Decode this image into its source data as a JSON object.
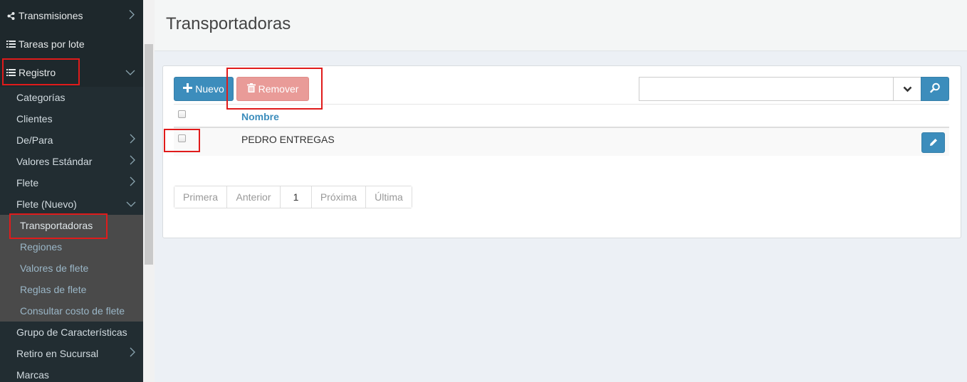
{
  "sidebar": {
    "top_items": [
      {
        "label": "Transmisiones",
        "icon": "share-icon",
        "chevron": "right"
      },
      {
        "label": "Tareas por lote",
        "icon": "list-alt-icon",
        "chevron": ""
      },
      {
        "label": "Registro",
        "icon": "list-icon",
        "chevron": "down"
      }
    ],
    "registro_items": [
      {
        "label": "Categorías"
      },
      {
        "label": "Clientes"
      },
      {
        "label": "De/Para"
      },
      {
        "label": "Valores Estándar"
      },
      {
        "label": "Flete"
      },
      {
        "label": "Flete (Nuevo)"
      }
    ],
    "flete_nuevo_items": [
      {
        "label": "Transportadoras"
      },
      {
        "label": "Regiones"
      },
      {
        "label": "Valores de flete"
      },
      {
        "label": "Reglas de flete"
      },
      {
        "label": "Consultar costo de flete"
      }
    ],
    "after_items": [
      {
        "label": "Grupo de Características"
      },
      {
        "label": "Retiro en Sucursal"
      },
      {
        "label": "Marcas"
      }
    ]
  },
  "header": {
    "title": "Transportadoras"
  },
  "toolbar": {
    "nuevo_label": "Nuevo",
    "remover_label": "Remover",
    "search_value": ""
  },
  "table": {
    "columns": [
      {
        "label": "Nombre"
      }
    ],
    "rows": [
      {
        "nombre": "PEDRO ENTREGAS"
      }
    ]
  },
  "pagination": {
    "first": "Primera",
    "prev": "Anterior",
    "current": "1",
    "next": "Próxima",
    "last": "Última"
  },
  "colors": {
    "primary": "#3c8dbc",
    "danger_disabled": "#e99b98",
    "sidebar_bg": "#222d32",
    "highlight": "#e01b1b"
  }
}
